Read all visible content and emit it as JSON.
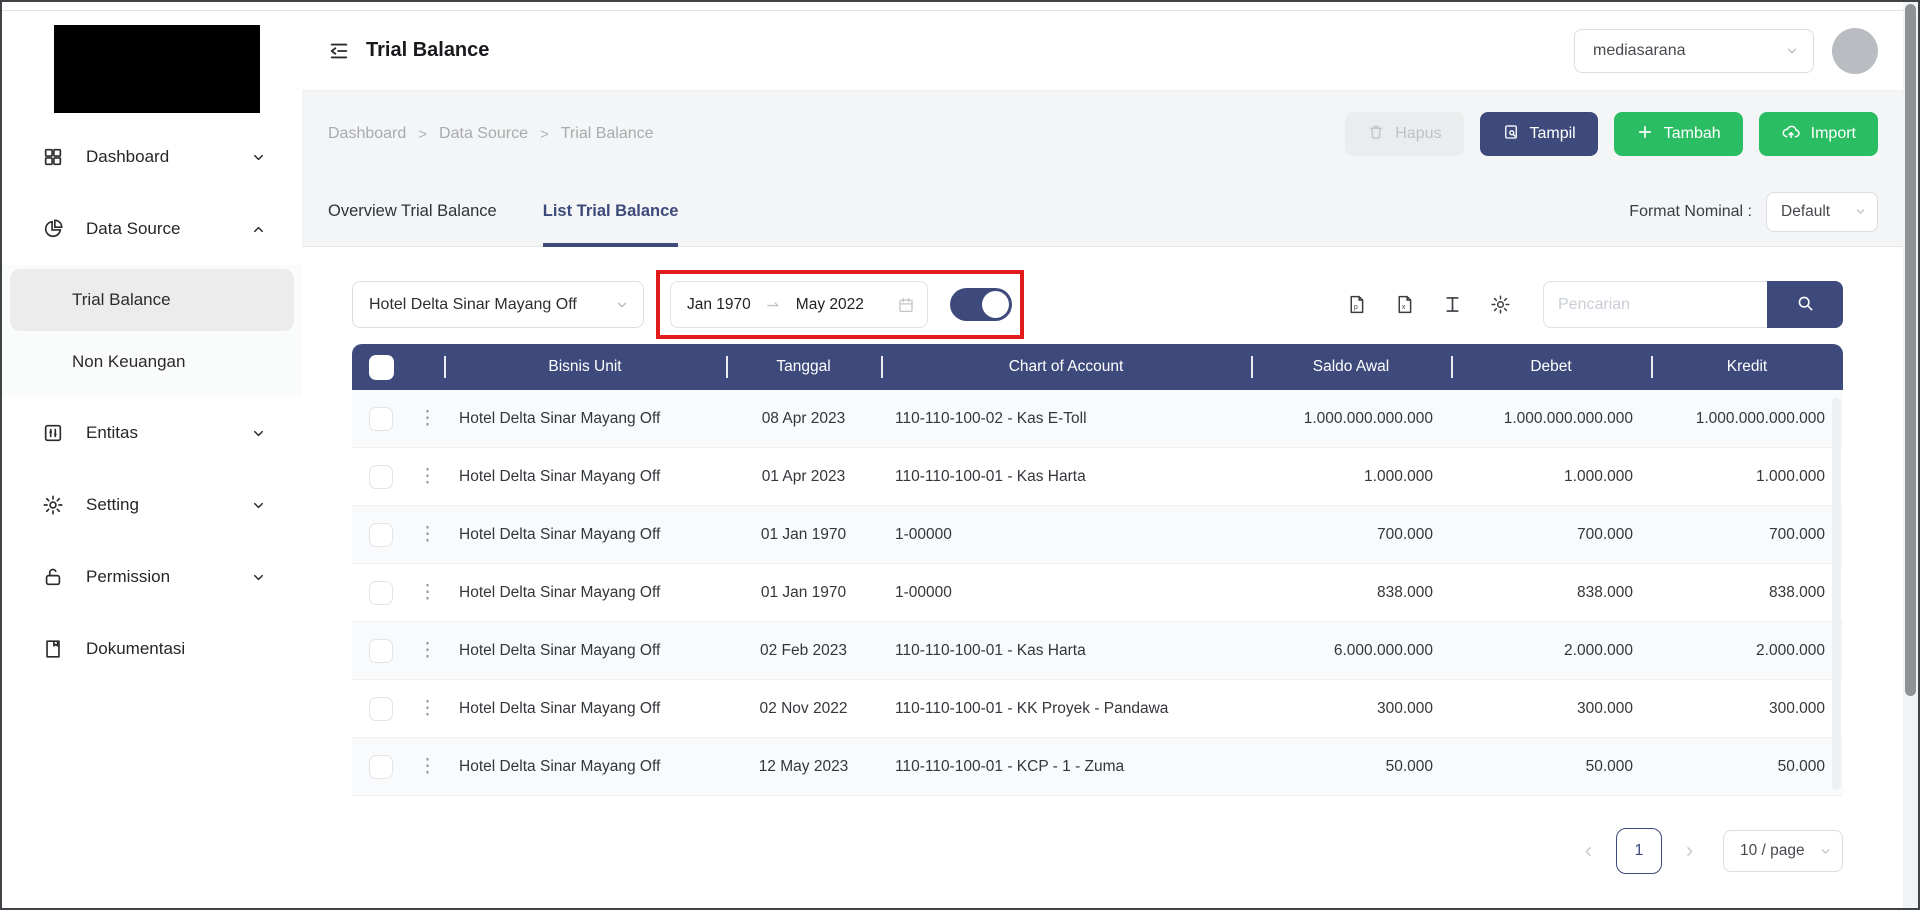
{
  "header": {
    "page_title": "Trial Balance",
    "workspace": "mediasarana"
  },
  "sidebar": {
    "items": [
      {
        "label": "Dashboard",
        "icon": "grid-icon",
        "chevron": "down"
      },
      {
        "label": "Data Source",
        "icon": "pie-chart-icon",
        "chevron": "up"
      },
      {
        "label": "Entitas",
        "icon": "sliders-icon",
        "chevron": "down"
      },
      {
        "label": "Setting",
        "icon": "gear-icon",
        "chevron": "down"
      },
      {
        "label": "Permission",
        "icon": "unlock-icon",
        "chevron": "down"
      },
      {
        "label": "Dokumentasi",
        "icon": "document-icon",
        "chevron": "none"
      }
    ],
    "submenu": [
      {
        "label": "Trial Balance",
        "active": true
      },
      {
        "label": "Non Keuangan",
        "active": false
      }
    ]
  },
  "breadcrumb": {
    "items": [
      "Dashboard",
      "Data Source",
      "Trial Balance"
    ],
    "separator": ">"
  },
  "actions": {
    "hapus": "Hapus",
    "tampil": "Tampil",
    "tambah": "Tambah",
    "import": "Import"
  },
  "tabs": {
    "overview": "Overview Trial Balance",
    "list": "List Trial Balance"
  },
  "format_nominal": {
    "label": "Format Nominal :",
    "value": "Default"
  },
  "filters": {
    "business_unit": "Hotel Delta Sinar Mayang Off",
    "date_start": "Jan 1970",
    "date_end": "May 2022",
    "toggle_on": true,
    "search_placeholder": "Pencarian"
  },
  "table": {
    "columns": [
      "Bisnis Unit",
      "Tanggal",
      "Chart of Account",
      "Saldo Awal",
      "Debet",
      "Kredit"
    ],
    "rows": [
      {
        "bu": "Hotel Delta Sinar Mayang Off",
        "tanggal": "08 Apr 2023",
        "coa": "110-110-100-02 - Kas E-Toll",
        "saldo": "1.000.000.000.000",
        "debet": "1.000.000.000.000",
        "kredit": "1.000.000.000.000"
      },
      {
        "bu": "Hotel Delta Sinar Mayang Off",
        "tanggal": "01 Apr 2023",
        "coa": "110-110-100-01 - Kas Harta",
        "saldo": "1.000.000",
        "debet": "1.000.000",
        "kredit": "1.000.000"
      },
      {
        "bu": "Hotel Delta Sinar Mayang Off",
        "tanggal": "01 Jan 1970",
        "coa": "1-00000",
        "saldo": "700.000",
        "debet": "700.000",
        "kredit": "700.000"
      },
      {
        "bu": "Hotel Delta Sinar Mayang Off",
        "tanggal": "01 Jan 1970",
        "coa": "1-00000",
        "saldo": "838.000",
        "debet": "838.000",
        "kredit": "838.000"
      },
      {
        "bu": "Hotel Delta Sinar Mayang Off",
        "tanggal": "02 Feb 2023",
        "coa": "110-110-100-01 - Kas Harta",
        "saldo": "6.000.000.000",
        "debet": "2.000.000",
        "kredit": "2.000.000"
      },
      {
        "bu": "Hotel Delta Sinar Mayang Off",
        "tanggal": "02 Nov 2022",
        "coa": "110-110-100-01 - KK Proyek - Pandawa",
        "saldo": "300.000",
        "debet": "300.000",
        "kredit": "300.000"
      },
      {
        "bu": "Hotel Delta Sinar Mayang Off",
        "tanggal": "12 May 2023",
        "coa": "110-110-100-01 - KCP - 1 - Zuma",
        "saldo": "50.000",
        "debet": "50.000",
        "kredit": "50.000"
      }
    ]
  },
  "pagination": {
    "current_page": "1",
    "page_size": "10 / page"
  },
  "colors": {
    "primary": "#3E4A7B",
    "green": "#2BBD63",
    "annotation_red": "#E11B1B"
  }
}
